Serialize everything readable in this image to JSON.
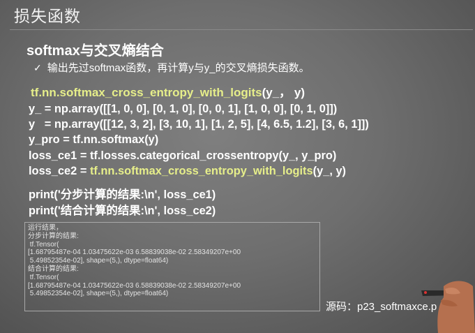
{
  "slide": {
    "title": "损失函数",
    "subheading": "softmax与交叉熵结合",
    "bullet": "输出先过softmax函数，再计算y与y_的交叉熵损失函数。",
    "api_func": "tf.nn.softmax_cross_entropy_with_logits",
    "api_args": "(y_， y)",
    "code_lines": [
      {
        "pre": "y_ = np.array([[1, 0, 0], [0, 1, 0], [0, 0, 1], [1, 0, 0], [0, 1, 0]])",
        "hl": "",
        "post": ""
      },
      {
        "pre": "y   = np.array([[12, 3, 2], [3, 10, 1], [1, 2, 5], [4, 6.5, 1.2], [3, 6, 1]])",
        "hl": "",
        "post": ""
      },
      {
        "pre": "y_pro = tf.nn.softmax(y)",
        "hl": "",
        "post": ""
      },
      {
        "pre": "loss_ce1 = tf.losses.categorical_crossentropy(y_, y_pro)",
        "hl": "",
        "post": ""
      },
      {
        "pre": "loss_ce2 = ",
        "hl": "tf.nn.softmax_cross_entropy_with_logits",
        "post": "(y_, y)"
      }
    ],
    "print_lines": [
      "print('分步计算的结果:\\n', loss_ce1)",
      "print('结合计算的结果:\\n', loss_ce2)"
    ],
    "output_lines": [
      "运行结果，",
      "分步计算的结果:",
      " tf.Tensor(",
      "[1.68795487e-04 1.03475622e-03 6.58839038e-02 2.58349207e+00",
      " 5.49852354e-02], shape=(5,), dtype=float64)",
      "结合计算的结果:",
      " tf.Tensor(",
      "[1.68795487e-04 1.03475622e-03 6.58839038e-02 2.58349207e+00",
      " 5.49852354e-02], shape=(5,), dtype=float64)"
    ],
    "source": "源码：p23_softmaxce.p",
    "icons": {
      "bullet": "check-icon",
      "presenter": "presenter-hand-with-clicker"
    },
    "colors": {
      "highlight": "#e6ee8a",
      "text": "#ffffff",
      "background": "#6e6e6e"
    }
  }
}
